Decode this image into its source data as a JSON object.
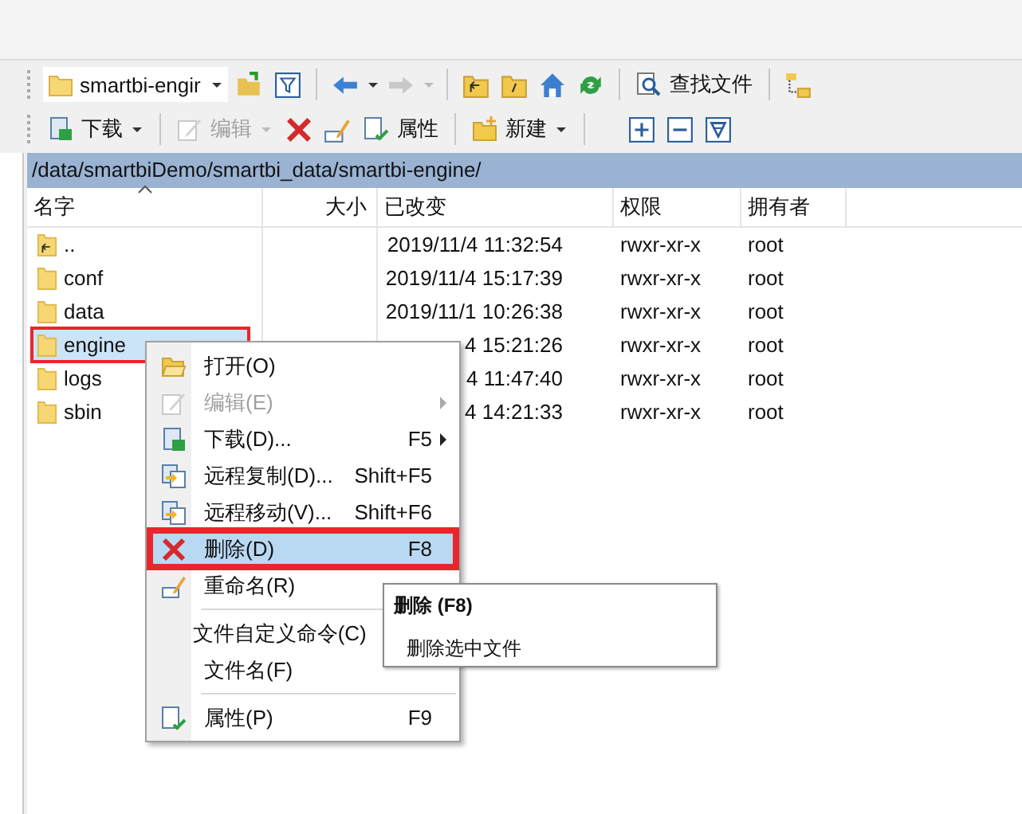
{
  "toolbar_1": {
    "folder": "smartbi-engir",
    "find_button": "查找文件"
  },
  "toolbar_2": {
    "download": "下载",
    "edit": "编辑",
    "edit_disabled": true,
    "properties": "属性",
    "new": "新建"
  },
  "path": "/data/smartbiDemo/smartbi_data/smartbi-engine/",
  "columns": [
    {
      "label": "名字",
      "sorted": true
    },
    {
      "label": "大小",
      "sorted": false
    },
    {
      "label": "已改变",
      "sorted": false
    },
    {
      "label": "权限",
      "sorted": false
    },
    {
      "label": "拥有者",
      "sorted": false
    }
  ],
  "rows": [
    {
      "kind": "parent",
      "name": "..",
      "modified": "2019/11/4 11:32:54",
      "rights": "rwxr-xr-x",
      "owner": "root",
      "selected": false,
      "marked": false
    },
    {
      "kind": "folder",
      "name": "conf",
      "modified": "2019/11/4 15:17:39",
      "rights": "rwxr-xr-x",
      "owner": "root",
      "selected": false,
      "marked": false
    },
    {
      "kind": "folder",
      "name": "data",
      "modified": "2019/11/1 10:26:38",
      "rights": "rwxr-xr-x",
      "owner": "root",
      "selected": false,
      "marked": false
    },
    {
      "kind": "folder",
      "name": "engine",
      "modified": "4 15:21:26",
      "rights": "rwxr-xr-x",
      "owner": "root",
      "selected": true,
      "marked": true
    },
    {
      "kind": "folder",
      "name": "logs",
      "modified": "4 11:47:40",
      "rights": "rwxr-xr-x",
      "owner": "root",
      "selected": false,
      "marked": false
    },
    {
      "kind": "folder",
      "name": "sbin",
      "modified": "4 14:21:33",
      "rights": "rwxr-xr-x",
      "owner": "root",
      "selected": false,
      "marked": false
    }
  ],
  "context_menu": [
    {
      "kind": "item",
      "label": "打开(O)",
      "disabled": false,
      "submenu": false,
      "selected": false,
      "marked": false
    },
    {
      "kind": "item",
      "label": "编辑(E)",
      "disabled": true,
      "submenu": true,
      "selected": false,
      "marked": false
    },
    {
      "kind": "item",
      "label": "下载(D)...",
      "shortcut": "F5",
      "disabled": false,
      "submenu": true,
      "selected": false,
      "marked": false
    },
    {
      "kind": "item",
      "label": "远程复制(D)...",
      "shortcut": "Shift+F5",
      "disabled": false,
      "submenu": false,
      "selected": false,
      "marked": false
    },
    {
      "kind": "item",
      "label": "远程移动(V)...",
      "shortcut": "Shift+F6",
      "disabled": false,
      "submenu": false,
      "selected": false,
      "marked": false
    },
    {
      "kind": "item",
      "label": "删除(D)",
      "shortcut": "F8",
      "disabled": false,
      "submenu": false,
      "selected": true,
      "marked": true
    },
    {
      "kind": "item",
      "label": "重命名(R)",
      "disabled": false,
      "submenu": false,
      "selected": false,
      "marked": false
    },
    {
      "kind": "separator"
    },
    {
      "kind": "item",
      "label": "文件自定义命令(C)",
      "disabled": false,
      "submenu": false,
      "selected": false,
      "marked": false
    },
    {
      "kind": "item",
      "label": "文件名(F)",
      "disabled": false,
      "submenu": false,
      "selected": false,
      "marked": false
    },
    {
      "kind": "separator"
    },
    {
      "kind": "item",
      "label": "属性(P)",
      "shortcut": "F9",
      "disabled": false,
      "submenu": false,
      "selected": false,
      "marked": false
    }
  ],
  "tooltip": {
    "title": "删除 (F8)",
    "text": "删除选中文件"
  }
}
